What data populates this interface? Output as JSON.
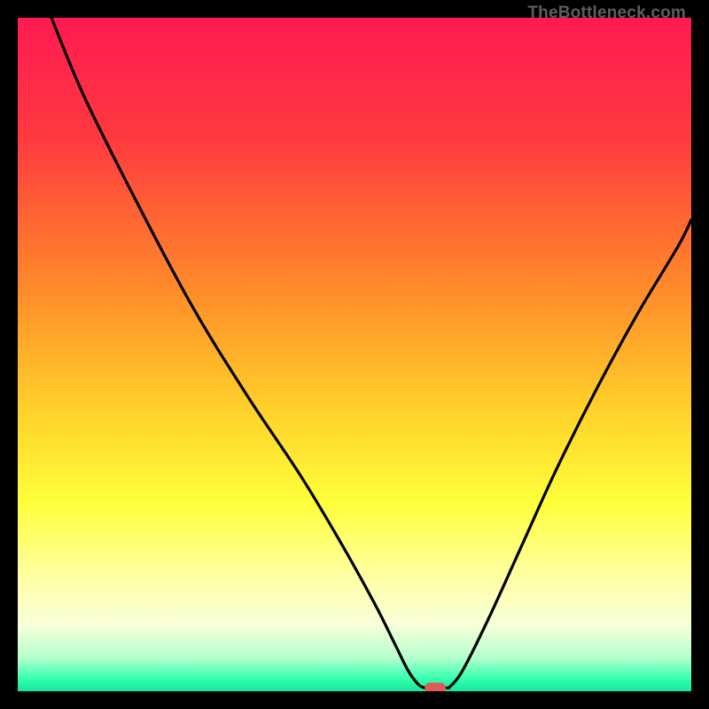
{
  "watermark": "TheBottleneck.com",
  "chart_data": {
    "type": "line",
    "title": "",
    "xlabel": "",
    "ylabel": "",
    "xlim": [
      0,
      100
    ],
    "ylim": [
      0,
      100
    ],
    "gradient_stops": [
      {
        "offset": 0,
        "color": "#ff1a52"
      },
      {
        "offset": 18,
        "color": "#ff3a3f"
      },
      {
        "offset": 40,
        "color": "#ff8a2a"
      },
      {
        "offset": 58,
        "color": "#ffd02a"
      },
      {
        "offset": 72,
        "color": "#ffff3a"
      },
      {
        "offset": 82,
        "color": "#ffff9a"
      },
      {
        "offset": 90,
        "color": "#f8ffd8"
      },
      {
        "offset": 95,
        "color": "#b6ffce"
      },
      {
        "offset": 98,
        "color": "#3affb0"
      },
      {
        "offset": 100,
        "color": "#12e89a"
      }
    ],
    "series": [
      {
        "name": "bottleneck-curve-left",
        "x": [
          5,
          10,
          18,
          26,
          34,
          42,
          48,
          53,
          56,
          58,
          59.5,
          60.5
        ],
        "y": [
          100,
          88,
          72,
          57,
          44,
          32,
          22,
          13,
          7,
          3,
          1,
          0.5
        ]
      },
      {
        "name": "bottleneck-curve-right",
        "x": [
          64,
          66,
          70,
          75,
          80,
          86,
          92,
          98,
          100
        ],
        "y": [
          0.5,
          3,
          11,
          22,
          33,
          45,
          56,
          66,
          70
        ]
      },
      {
        "name": "flat-segment",
        "x": [
          60.5,
          64
        ],
        "y": [
          0.5,
          0.5
        ]
      }
    ],
    "marker": {
      "name": "optimal-point",
      "x": 62,
      "y": 0.5,
      "color": "#e05a5a"
    }
  }
}
